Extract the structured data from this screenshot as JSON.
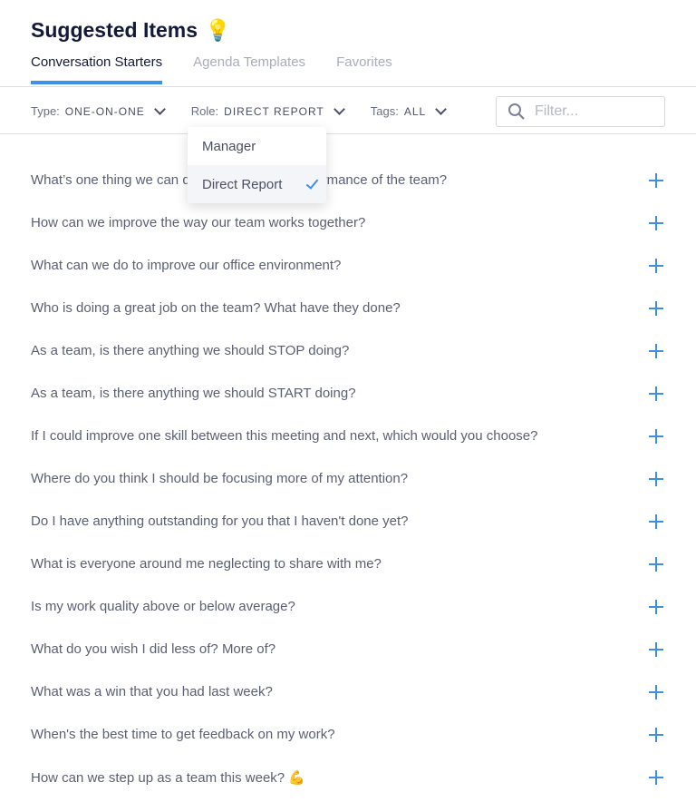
{
  "header": {
    "title": "Suggested Items",
    "title_emoji": "💡"
  },
  "tabs": [
    {
      "label": "Conversation Starters",
      "active": true
    },
    {
      "label": "Agenda Templates"
    },
    {
      "label": "Favorites"
    }
  ],
  "filters": {
    "type": {
      "label": "Type:",
      "value": "ONE-ON-ONE"
    },
    "role": {
      "label": "Role:",
      "value": "DIRECT REPORT"
    },
    "tags": {
      "label": "Tags:",
      "value": "ALL"
    },
    "search_placeholder": "Filter..."
  },
  "role_dropdown": {
    "options": [
      {
        "label": "Manager"
      },
      {
        "label": "Direct Report",
        "selected": true
      }
    ]
  },
  "items": [
    "What’s one thing we can do to improve the performance of the team?",
    "How can we improve the way our team works together?",
    "What can we do to improve our office environment?",
    "Who is doing a great job on the team? What have they done?",
    "As a team, is there anything we should STOP doing?",
    "As a team, is there anything we should START doing?",
    "If I could improve one skill between this meeting and next, which would you choose?",
    "Where do you think I should be focusing more of my attention?",
    "Do I have anything outstanding for you that I haven't done yet?",
    "What is everyone around me neglecting to share with me?",
    "Is my work quality above or below average?",
    "What do you wish I did less of? More of?",
    "What was a win that you had last week?",
    "When's the best time to get feedback on my work?",
    "How can we step up as a team this week? 💪"
  ],
  "colors": {
    "accent": "#3d8fe8",
    "title": "#14193a"
  }
}
